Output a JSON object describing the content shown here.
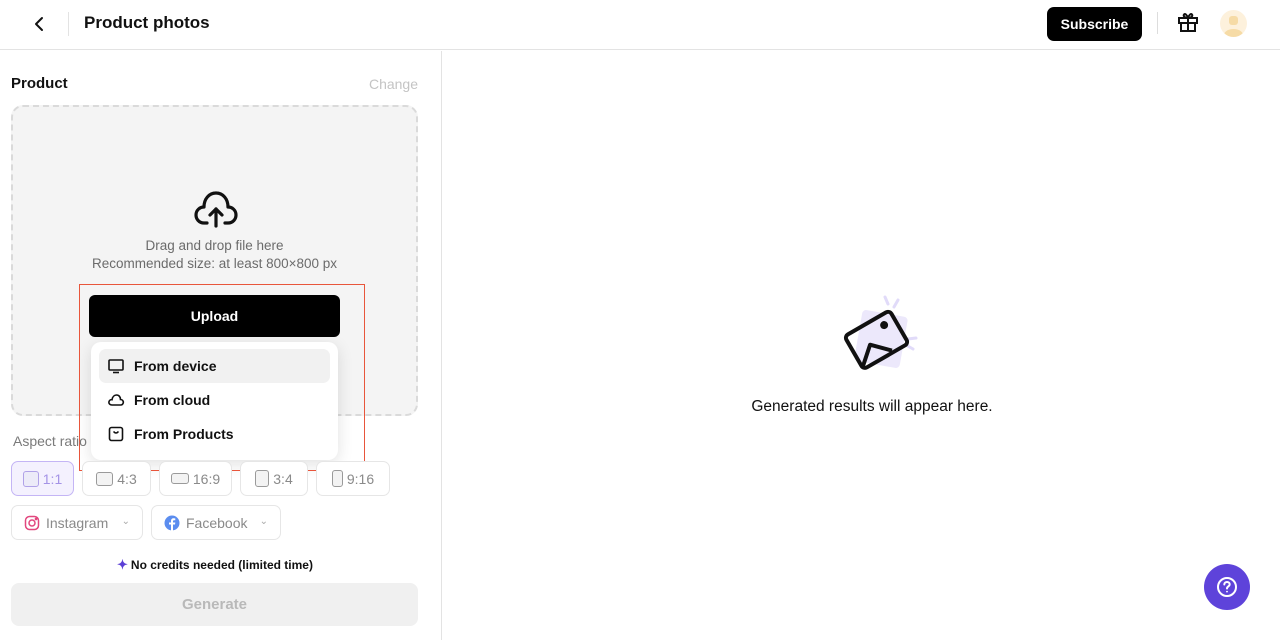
{
  "header": {
    "title": "Product photos",
    "subscribe_label": "Subscribe"
  },
  "product": {
    "section_title": "Product",
    "change_label": "Change",
    "dropzone_line1": "Drag and drop file here",
    "dropzone_line2": "Recommended size: at least 800×800 px",
    "upload_label": "Upload",
    "upload_menu": [
      {
        "label": "From device",
        "icon": "monitor-icon",
        "active": true
      },
      {
        "label": "From cloud",
        "icon": "cloud-icon",
        "active": false
      },
      {
        "label": "From Products",
        "icon": "shopping-bag-icon",
        "active": false
      }
    ]
  },
  "aspect_ratio": {
    "label": "Aspect ratio",
    "selected": "1:1",
    "options": [
      "1:1",
      "4:3",
      "16:9",
      "3:4",
      "9:16"
    ]
  },
  "social_presets": [
    {
      "label": "Instagram",
      "icon": "instagram-icon"
    },
    {
      "label": "Facebook",
      "icon": "facebook-icon"
    }
  ],
  "credits_note": "No credits needed (limited time)",
  "generate_label": "Generate",
  "results": {
    "empty_text": "Generated results will appear here."
  },
  "colors": {
    "accent": "#5e43da",
    "highlight_box": "#e8553b"
  }
}
